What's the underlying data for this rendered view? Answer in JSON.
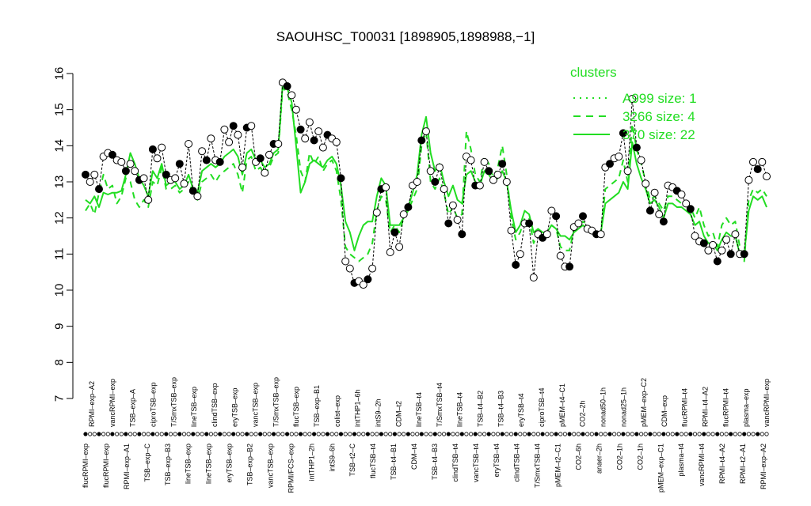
{
  "chart_data": {
    "type": "line",
    "title": "SAOUHSC_T00031 [1898905,1898988,−1]",
    "ylim": [
      7,
      16
    ],
    "yticks": [
      7,
      8,
      9,
      10,
      11,
      12,
      13,
      14,
      15,
      16
    ],
    "accent_color": "#22dd22",
    "legend": {
      "title": "clusters",
      "placement": "top-right",
      "entries": [
        {
          "label": "A999 size: 1",
          "style": "dotted"
        },
        {
          "label": "3266 size: 4",
          "style": "dashed"
        },
        {
          "label": "370 size: 22",
          "style": "solid"
        }
      ]
    },
    "x_labels_top": [
      "RPMI–exp–A2",
      "vancRPMI–exp",
      "TSB–exp–A",
      "ciproTSB–exp",
      "T/SmxTSB–exp",
      "lineTSB–exp",
      "clindTSB–exp",
      "eryTSB–exp",
      "vancTSB–exp",
      "T/SmxTSB–exp",
      "flucTSB–exp",
      "TSB–exp–B1",
      "colist–exp",
      "intTHP1–6h",
      "intS9–2h",
      "CDM–t2",
      "lineTSB–t4",
      "T/SmxTSB–t4",
      "lineTSB–t4",
      "TSB–t4–B2",
      "TSB–t4–B3",
      "eryTSB–t4",
      "ciproTSB–t4",
      "pMEM–t4–C1",
      "CO2–2h",
      "nonad50–1h",
      "nonad25–1h",
      "pMEM–exp–C2",
      "CDM–exp",
      "flucRPMI–t4",
      "RPMI–t4–A2",
      "flucRPMI–t4",
      "plasma–exp",
      "vancRPMI–exp"
    ],
    "x_labels_bottom": [
      "flucRPMI–exp",
      "flucRPMI–exp",
      "RPMI–exp–A1",
      "TSB–exp–C",
      "TSB–exp–B3",
      "lineTSB–exp",
      "lineTSB–exp",
      "eryTSB–exp",
      "TSB–exp–B2",
      "vancTSB–exp",
      "RPMI/FCS–exp",
      "intTHP1–2h",
      "intS9–6h",
      "TSB–t2–C",
      "flucTSB–t4",
      "TSB–t4–B1",
      "CDM–t4",
      "TSB–t4–B3",
      "clindTSB–t4",
      "vancTSB–t4",
      "eryTSB–t4",
      "clindTSB–t4",
      "T/SmxTSB–t4",
      "pMEM–t2–C1",
      "CO2–6h",
      "anaer–2h",
      "CO2–1h",
      "CO2–1h",
      "pMEM–exp–C1",
      "plasma–t4",
      "vancRPMI–t4",
      "RPMI–t4–A2",
      "RPMI–t2–A1",
      "RPMI–exp–A2"
    ],
    "series": [
      {
        "marker": "points",
        "values": [
          13.2,
          13.0,
          13.2,
          12.8,
          13.7,
          13.8,
          13.75,
          13.6,
          13.55,
          13.3,
          13.5,
          13.3,
          13.05,
          13.1,
          12.5,
          13.9,
          13.65,
          13.95,
          13.2,
          13.05,
          13.1,
          13.5,
          12.95,
          14.05,
          12.75,
          12.6,
          13.85,
          13.6,
          14.2,
          13.6,
          13.55,
          14.45,
          14.1,
          14.55,
          14.3,
          13.4,
          14.5,
          14.55,
          13.55,
          13.65,
          13.25,
          13.75,
          14.05,
          14.05,
          15.75,
          15.65,
          15.4,
          15.0,
          14.45,
          14.2,
          14.65,
          14.15,
          14.4,
          13.95,
          14.3,
          14.2,
          14.1,
          13.1,
          10.8,
          10.6,
          10.2,
          10.25,
          10.15,
          10.3,
          10.6,
          12.15,
          12.8,
          12.85,
          11.05,
          11.6,
          11.2,
          12.1,
          12.3,
          12.9,
          13.0,
          14.15,
          14.4,
          13.3,
          13.0,
          13.4,
          12.8,
          11.85,
          12.35,
          11.95,
          11.55,
          13.7,
          13.6,
          12.9,
          12.9,
          13.55,
          13.3,
          13.05,
          13.2,
          13.5,
          13.0,
          11.65,
          10.7,
          11.0,
          11.85,
          11.85,
          10.35,
          11.55,
          11.45,
          11.55,
          12.2,
          12.05,
          10.95,
          10.65,
          10.65,
          11.75,
          11.85,
          12.05,
          11.7,
          11.65,
          11.55,
          11.55,
          13.4,
          13.5,
          13.65,
          13.7,
          14.35,
          13.3,
          15.3,
          13.95,
          13.6,
          12.95,
          12.2,
          12.7,
          12.1,
          11.9,
          12.9,
          12.85,
          12.75,
          12.65,
          12.4,
          12.25,
          11.5,
          11.35,
          11.3,
          11.1,
          11.25,
          10.8,
          11.1,
          11.4,
          11.0,
          11.55,
          11.0,
          11.0,
          13.05,
          13.55,
          13.35,
          13.55,
          13.15
        ]
      },
      {
        "name": "3266 size: 4",
        "style": "dashed",
        "values": [
          12.2,
          12.4,
          12.1,
          12.7,
          13.2,
          12.8,
          12.9,
          12.4,
          12.6,
          13.1,
          13.0,
          12.5,
          12.3,
          12.5,
          12.3,
          13.0,
          12.9,
          13.4,
          12.8,
          12.8,
          12.9,
          12.7,
          12.8,
          13.0,
          12.7,
          12.5,
          13.0,
          13.1,
          13.2,
          13.0,
          13.2,
          13.3,
          13.4,
          13.5,
          13.2,
          12.7,
          13.6,
          13.7,
          13.3,
          13.4,
          13.2,
          13.4,
          13.7,
          13.8,
          15.6,
          15.5,
          15.0,
          14.3,
          13.3,
          13.0,
          13.8,
          13.5,
          13.7,
          13.3,
          13.5,
          13.6,
          13.3,
          12.5,
          11.2,
          11.0,
          10.9,
          10.8,
          10.9,
          11.0,
          11.3,
          12.2,
          12.6,
          12.5,
          11.6,
          11.8,
          11.6,
          12.0,
          12.2,
          12.5,
          12.8,
          14.0,
          14.4,
          13.0,
          12.8,
          13.1,
          12.7,
          12.1,
          12.3,
          12.0,
          12.1,
          14.4,
          13.9,
          13.2,
          13.0,
          13.7,
          13.5,
          13.1,
          13.4,
          14.0,
          13.2,
          12.0,
          11.4,
          11.6,
          12.0,
          12.0,
          11.3,
          11.6,
          11.5,
          11.6,
          11.8,
          11.7,
          11.2,
          11.1,
          11.1,
          11.7,
          11.8,
          11.9,
          11.8,
          11.7,
          11.6,
          11.6,
          12.8,
          12.9,
          13.0,
          13.1,
          13.6,
          13.0,
          14.6,
          13.9,
          13.5,
          13.0,
          12.5,
          12.6,
          12.4,
          12.2,
          12.6,
          12.6,
          12.5,
          12.4,
          12.4,
          12.3,
          12.0,
          12.3,
          11.8,
          11.5,
          11.6,
          11.2,
          11.8,
          12.0,
          11.8,
          11.9,
          11.2,
          10.8,
          12.5,
          12.8,
          12.7,
          12.8,
          12.6
        ]
      },
      {
        "name": "370 size: 22",
        "style": "solid",
        "values": [
          12.5,
          12.4,
          12.6,
          12.3,
          12.7,
          12.65,
          12.7,
          12.7,
          12.75,
          13.2,
          13.8,
          13.5,
          13.1,
          12.9,
          12.6,
          13.3,
          13.1,
          13.5,
          12.9,
          13.0,
          13.0,
          12.8,
          12.9,
          13.2,
          12.8,
          12.7,
          13.3,
          13.4,
          13.5,
          13.4,
          13.5,
          13.7,
          13.8,
          13.9,
          13.7,
          13.2,
          13.8,
          13.9,
          13.6,
          13.6,
          13.4,
          13.5,
          13.8,
          13.9,
          15.7,
          15.6,
          15.2,
          14.0,
          12.7,
          13.0,
          13.5,
          13.6,
          13.5,
          13.4,
          13.6,
          13.7,
          13.5,
          12.9,
          11.9,
          11.6,
          11.1,
          11.5,
          11.8,
          11.9,
          11.9,
          12.6,
          13.1,
          12.9,
          11.8,
          11.8,
          11.8,
          12.0,
          12.3,
          12.7,
          13.2,
          14.3,
          14.8,
          13.8,
          13.3,
          13.5,
          13.0,
          12.6,
          12.9,
          12.5,
          12.4,
          13.2,
          13.3,
          13.0,
          12.9,
          13.3,
          13.2,
          13.0,
          13.1,
          13.3,
          13.0,
          12.2,
          11.6,
          11.8,
          12.2,
          12.1,
          11.6,
          11.7,
          11.6,
          11.6,
          11.8,
          11.7,
          11.5,
          11.5,
          11.4,
          11.6,
          11.7,
          11.8,
          11.7,
          11.6,
          11.6,
          11.6,
          12.4,
          12.5,
          12.6,
          12.7,
          13.0,
          12.8,
          14.1,
          13.5,
          13.1,
          12.8,
          12.4,
          12.5,
          12.3,
          12.0,
          12.4,
          12.4,
          12.3,
          12.3,
          12.2,
          12.1,
          11.8,
          11.9,
          11.5,
          11.3,
          11.3,
          11.1,
          11.4,
          11.6,
          11.5,
          11.5,
          11.0,
          11.0,
          12.2,
          12.6,
          12.5,
          12.6,
          12.3
        ]
      }
    ]
  }
}
